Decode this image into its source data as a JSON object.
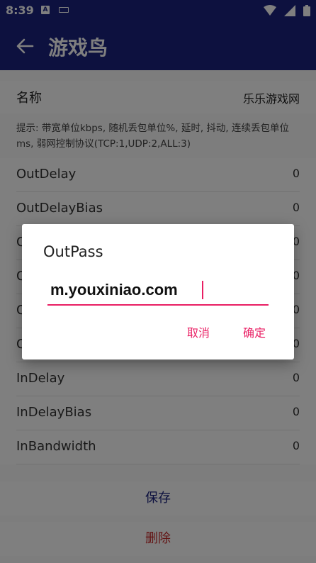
{
  "status_bar": {
    "time": "8:39",
    "notif_icon_letter": "A"
  },
  "app_bar": {
    "title": "游戏鸟"
  },
  "form": {
    "name_label": "名称",
    "name_value": "乐乐游戏网",
    "hint": "提示: 带宽单位kbps, 随机丢包单位%, 延时, 抖动, 连续丢包单位ms, 弱网控制协议(TCP:1,UDP:2,ALL:3)",
    "rows": [
      {
        "key": "OutDelay",
        "value": "0"
      },
      {
        "key": "OutDelayBias",
        "value": "0"
      },
      {
        "key": "O",
        "value": "0"
      },
      {
        "key": "O",
        "value": "0"
      },
      {
        "key": "O",
        "value": "0"
      },
      {
        "key": "O",
        "value": "0"
      },
      {
        "key": "InDelay",
        "value": "0"
      },
      {
        "key": "InDelayBias",
        "value": "0"
      },
      {
        "key": "InBandwidth",
        "value": "0"
      }
    ],
    "save_label": "保存",
    "delete_label": "删除"
  },
  "dialog": {
    "title": "OutPass",
    "input_value": "m.youxiniao.com",
    "cancel_label": "取消",
    "ok_label": "确定"
  },
  "colors": {
    "primary": "#1a237e",
    "accent": "#e91e63",
    "danger": "#c62828"
  }
}
